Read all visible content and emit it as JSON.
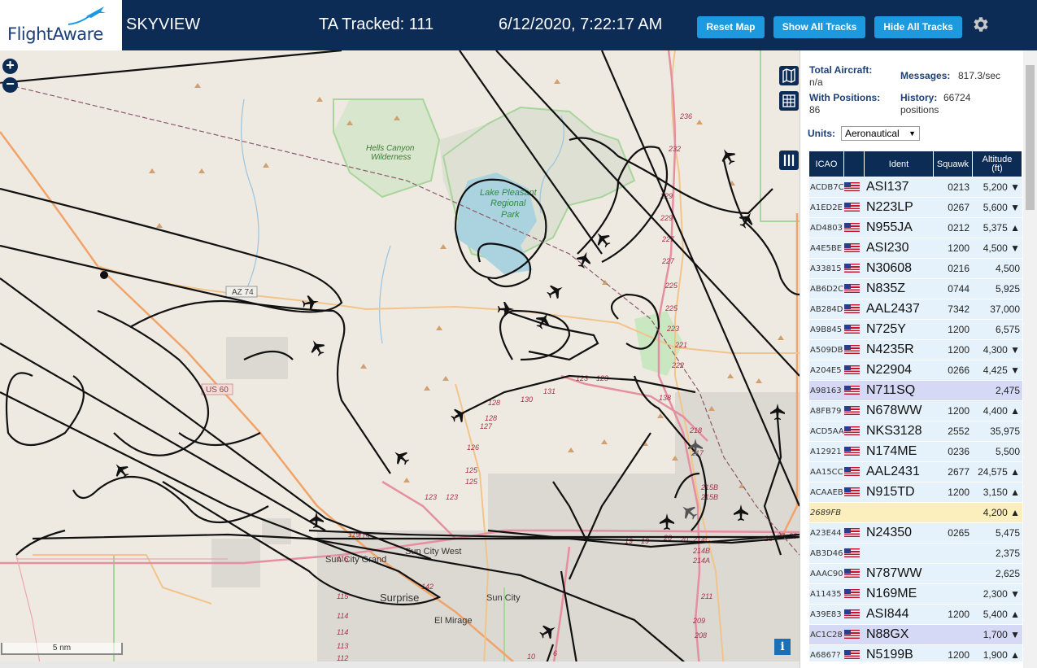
{
  "header": {
    "logo_text": "FlightAware",
    "app_title": "SKYVIEW",
    "tracked": "TA Tracked: 111",
    "clock": "6/12/2020, 7:22:17 AM",
    "reset_map": "Reset Map",
    "show_all": "Show All Tracks",
    "hide_all": "Hide All Tracks",
    "colors": {
      "bar": "#0c2b55",
      "button": "#1b9ae0"
    }
  },
  "map": {
    "zoom_in": "+",
    "zoom_out": "−",
    "scale": "5 nm",
    "info": "i",
    "labels": {
      "hells_canyon": "Hells Canyon",
      "wilderness": "Wilderness",
      "lake": "Lake Pleasant",
      "regional": "Regional",
      "park": "Park",
      "az74": "AZ 74",
      "us60": "US 60",
      "sun_city_grand": "Sun City Grand",
      "sun_city_west": "Sun City West",
      "sun_city": "Sun City",
      "surprise": "Surprise",
      "el_mirage": "El Mirage"
    },
    "route_numbers": [
      "236",
      "232",
      "229",
      "229",
      "227",
      "227",
      "225",
      "225",
      "223",
      "221",
      "222",
      "218",
      "217",
      "215B",
      "215B",
      "214C",
      "214B",
      "214A",
      "211",
      "209",
      "208",
      "131",
      "130",
      "128",
      "128",
      "127",
      "126",
      "125",
      "125",
      "123",
      "123",
      "123",
      "123",
      "119",
      "119",
      "116",
      "115",
      "114",
      "114",
      "113",
      "112",
      "10",
      "6",
      "19",
      "19",
      "20",
      "20",
      "26",
      "27",
      "28",
      "142",
      "138"
    ]
  },
  "sidebar": {
    "total_aircraft_label": "Total Aircraft:",
    "total_aircraft_value": "n/a",
    "with_positions_label": "With Positions:",
    "with_positions_value": "86",
    "messages_label": "Messages:",
    "messages_value": "817.3/sec",
    "history_label": "History:",
    "history_value": "66724",
    "history_unit": "positions",
    "units_label": "Units:",
    "units_value": "Aeronautical",
    "columns": {
      "icao": "ICAO",
      "ident": "Ident",
      "squawk": "Squawk",
      "altitude": "Altitude",
      "altitude_unit": "(ft)"
    },
    "rows": [
      {
        "icao": "ACDB7C",
        "ident": "ASI137",
        "squawk": "0213",
        "alt": "5,200 ▼"
      },
      {
        "icao": "A1ED2E",
        "ident": "N223LP",
        "squawk": "0267",
        "alt": "5,600 ▼"
      },
      {
        "icao": "AD4803",
        "ident": "N955JA",
        "squawk": "0212",
        "alt": "5,375 ▲"
      },
      {
        "icao": "A4E5BE",
        "ident": "ASI230",
        "squawk": "1200",
        "alt": "4,500 ▼"
      },
      {
        "icao": "A33815",
        "ident": "N30608",
        "squawk": "0216",
        "alt": "4,500"
      },
      {
        "icao": "AB6D2C",
        "ident": "N835Z",
        "squawk": "0744",
        "alt": "5,925"
      },
      {
        "icao": "AB284D",
        "ident": "AAL2437",
        "squawk": "7342",
        "alt": "37,000"
      },
      {
        "icao": "A9B845",
        "ident": "N725Y",
        "squawk": "1200",
        "alt": "6,575"
      },
      {
        "icao": "A509DB",
        "ident": "N4235R",
        "squawk": "1200",
        "alt": "4,300 ▼"
      },
      {
        "icao": "A204E5",
        "ident": "N22904",
        "squawk": "0266",
        "alt": "4,425 ▼"
      },
      {
        "icao": "A98163",
        "ident": "N711SQ",
        "squawk": "",
        "alt": "2,475"
      },
      {
        "icao": "A8FB79",
        "ident": "N678WW",
        "squawk": "1200",
        "alt": "4,400 ▲"
      },
      {
        "icao": "ACD5AA",
        "ident": "NKS3128",
        "squawk": "2552",
        "alt": "35,975"
      },
      {
        "icao": "A12921",
        "ident": "N174ME",
        "squawk": "0236",
        "alt": "5,500"
      },
      {
        "icao": "AA15CC",
        "ident": "AAL2431",
        "squawk": "2677",
        "alt": "24,575 ▲"
      },
      {
        "icao": "ACAAEB",
        "ident": "N915TD",
        "squawk": "1200",
        "alt": "3,150 ▲"
      },
      {
        "icao": "2689FB",
        "ident": "",
        "squawk": "",
        "alt": "4,200 ▲"
      },
      {
        "icao": "A23E44",
        "ident": "N24350",
        "squawk": "0265",
        "alt": "5,475"
      },
      {
        "icao": "AB3D46",
        "ident": "",
        "squawk": "",
        "alt": "2,375"
      },
      {
        "icao": "AAAC90",
        "ident": "N787WW",
        "squawk": "",
        "alt": "2,625"
      },
      {
        "icao": "A11435",
        "ident": "N169ME",
        "squawk": "",
        "alt": "2,300 ▼"
      },
      {
        "icao": "A39E83",
        "ident": "ASI844",
        "squawk": "1200",
        "alt": "5,400 ▲"
      },
      {
        "icao": "AC1C28",
        "ident": "N88GX",
        "squawk": "",
        "alt": "1,700 ▼"
      },
      {
        "icao": "A6867?",
        "ident": "N5199B",
        "squawk": "1200",
        "alt": "1,900 ▲"
      }
    ]
  }
}
